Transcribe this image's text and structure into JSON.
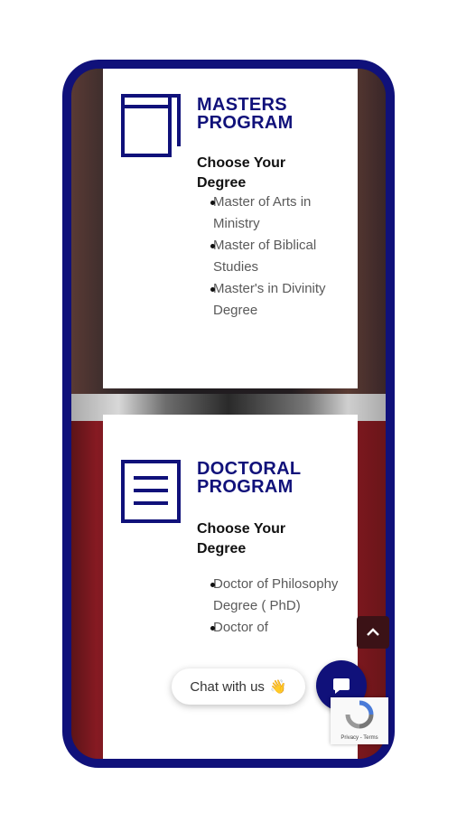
{
  "cards": [
    {
      "title_line1": "MASTERS",
      "title_line2": "PROGRAM",
      "subtitle": "Choose Your Degree",
      "items": [
        "Master of Arts in Ministry",
        "Master of Biblical Studies",
        "Master's in Divinity Degree"
      ],
      "icon": "book-icon"
    },
    {
      "title_line1": "DOCTORAL",
      "title_line2": "PROGRAM",
      "subtitle": "Choose Your Degree",
      "items": [
        "Doctor of Philosophy Degree ( PhD)",
        "Doctor of"
      ],
      "icon": "document-lines-icon"
    }
  ],
  "chat": {
    "label": "Chat with us",
    "emoji": "👋"
  },
  "recaptcha": {
    "links": "Privacy - Terms"
  },
  "colors": {
    "brand": "#10117a",
    "text": "#111111",
    "muted": "#5a5a5a"
  }
}
